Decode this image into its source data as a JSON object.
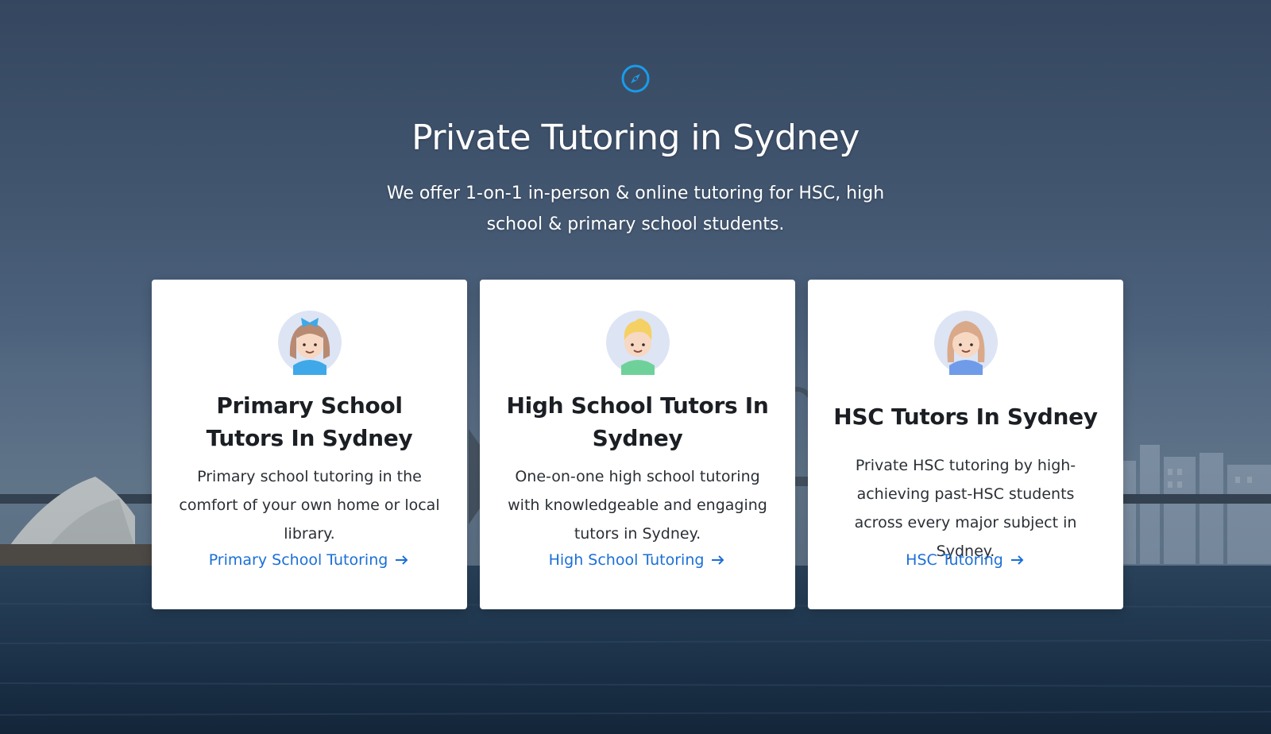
{
  "hero": {
    "title": "Private Tutoring in Sydney",
    "subtitle": "We offer 1-on-1 in-person & online tutoring for HSC, high school & primary school students.",
    "icon": "compass-icon",
    "accent_color": "#1a9bea"
  },
  "cards": [
    {
      "title": "Primary School Tutors In Sydney",
      "description": "Primary school tutoring in the comfort of your own home or local library.",
      "link_label": "Primary School Tutoring",
      "avatar": "girl-bow-avatar"
    },
    {
      "title": "High School Tutors In Sydney",
      "description": "One-on-one high school tutoring with knowledgeable and engaging tutors in Sydney.",
      "link_label": "High School Tutoring",
      "avatar": "boy-avatar"
    },
    {
      "title": "HSC Tutors In Sydney",
      "description": "Private HSC tutoring by high-achieving past-HSC students across every major subject in Sydney.",
      "link_label": "HSC Tutoring",
      "avatar": "girl-avatar"
    }
  ],
  "colors": {
    "link": "#1b6fd8",
    "card_bg": "#ffffff",
    "hero_bg": "#3e5068"
  }
}
